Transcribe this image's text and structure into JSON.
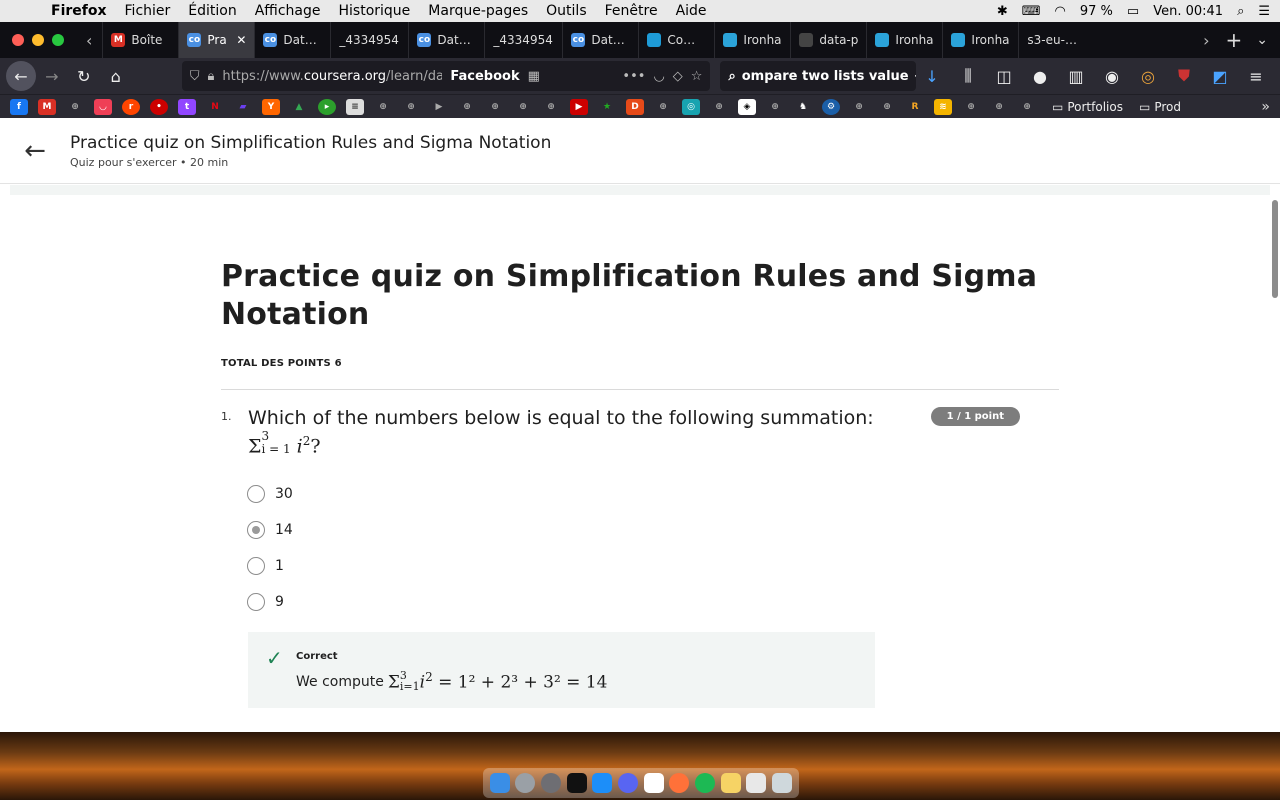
{
  "menubar": {
    "app": "Firefox",
    "items": [
      "Fichier",
      "Édition",
      "Affichage",
      "Historique",
      "Marque-pages",
      "Outils",
      "Fenêtre",
      "Aide"
    ],
    "battery": "97 %",
    "clock": "Ven. 00:41"
  },
  "tabs": [
    {
      "label": "Boîte",
      "icon": "gmail-icon",
      "color": "#d93025"
    },
    {
      "label": "Pra",
      "icon": "coursera-icon",
      "color": "#4a90e2",
      "active": true
    },
    {
      "label": "Data S",
      "icon": "coursera-icon",
      "color": "#4a90e2"
    },
    {
      "label": "_4334954",
      "icon": "",
      "color": ""
    },
    {
      "label": "Data S",
      "icon": "coursera-icon",
      "color": "#4a90e2"
    },
    {
      "label": "_4334954",
      "icon": "",
      "color": ""
    },
    {
      "label": "Data S",
      "icon": "coursera-icon",
      "color": "#4a90e2"
    },
    {
      "label": "Comm",
      "icon": "hex-icon",
      "color": "#1e9bd7"
    },
    {
      "label": "Ironha",
      "icon": "ironhack-icon",
      "color": "#2ba3d9"
    },
    {
      "label": "data-p",
      "icon": "github-icon",
      "color": "#444"
    },
    {
      "label": "Ironha",
      "icon": "ironhack-icon",
      "color": "#2ba3d9"
    },
    {
      "label": "Ironha",
      "icon": "ironhack-icon",
      "color": "#2ba3d9"
    },
    {
      "label": "s3-eu-wes",
      "icon": "",
      "color": ""
    }
  ],
  "navbar": {
    "url_prefix": "https://www.",
    "url_domain": "coursera.org",
    "url_path": "/learn/data",
    "pinned_label": "Facebook",
    "search_text": "ompare two lists value"
  },
  "bookmarks": {
    "folders": [
      "Portfolios",
      "Prod"
    ]
  },
  "page": {
    "header_title": "Practice quiz on Simplification Rules and Sigma Notation",
    "header_subtitle": "Quiz pour s'exercer • 20  min",
    "quiz_title": "Practice quiz on Simplification Rules and Sigma Notation",
    "total_points": "TOTAL DES POINTS 6",
    "question": {
      "number": "1.",
      "text": "Which of the numbers below is equal to the following summation:",
      "math_sigma": "Σ",
      "math_upper": "3",
      "math_lower": "i = 1",
      "math_body": "i",
      "math_exp": "2",
      "math_q": "?",
      "score": "1 / 1 point",
      "options": [
        {
          "label": "30",
          "selected": false
        },
        {
          "label": "14",
          "selected": true
        },
        {
          "label": "1",
          "selected": false
        },
        {
          "label": "9",
          "selected": false
        }
      ],
      "feedback": {
        "status": "Correct",
        "prefix": "We compute",
        "formula_lhs_upper": "3",
        "formula_lhs_lower": "i=1",
        "formula_rest": "= 1² + 2³ + 3² = 14"
      }
    }
  },
  "colors": {
    "correct": "#1f8354",
    "badge": "#7d7d7d",
    "feedback_bg": "#f2f5f4"
  }
}
